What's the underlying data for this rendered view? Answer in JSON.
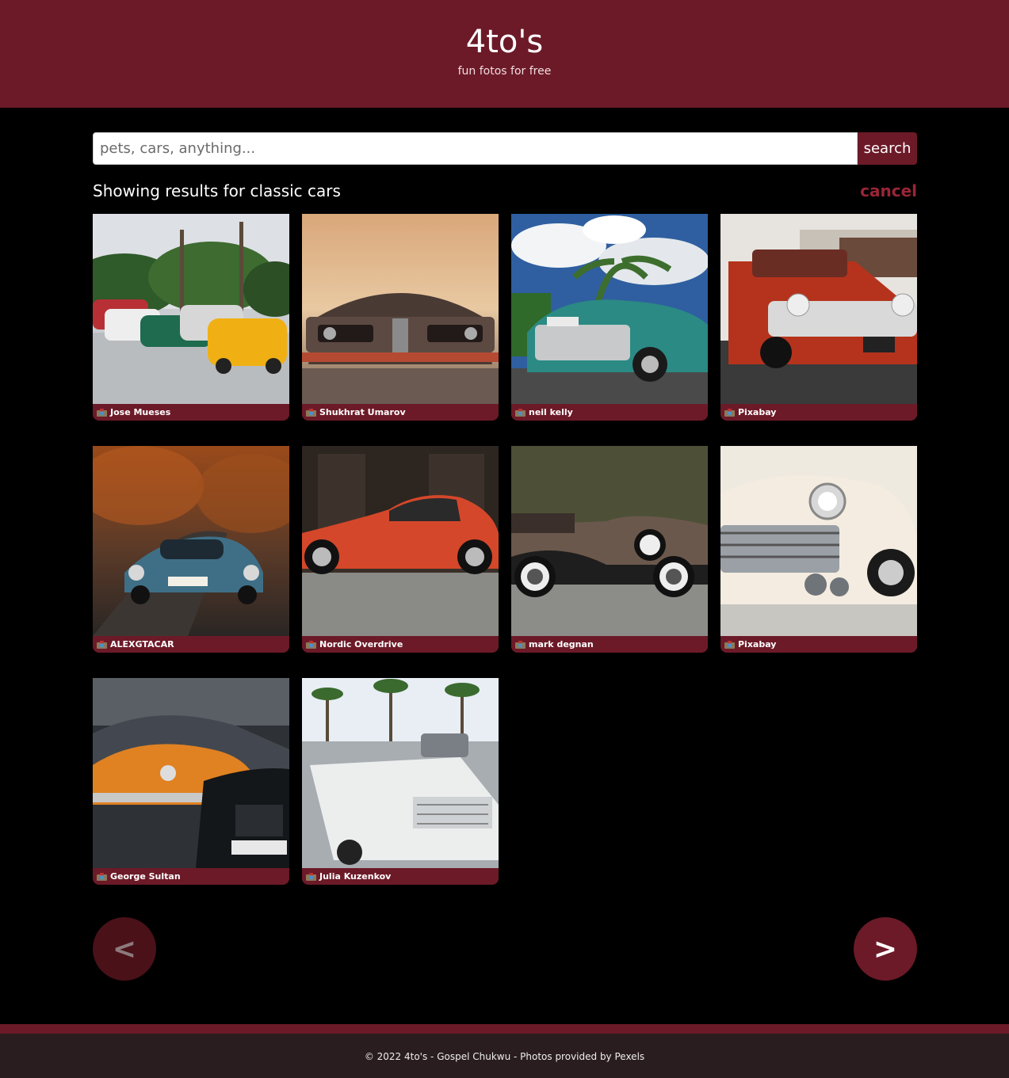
{
  "header": {
    "title": "4to's",
    "subtitle": "fun fotos for free"
  },
  "search": {
    "placeholder": "pets, cars, anything...",
    "value": "",
    "button_label": "search"
  },
  "results": {
    "label": "Showing results for classic cars",
    "cancel_label": "cancel"
  },
  "photos": [
    {
      "photographer": "Jose Mueses",
      "subject": "row of vintage cars with palm trees"
    },
    {
      "photographer": "Shukhrat Umarov",
      "subject": "muscle car front at sunset"
    },
    {
      "photographer": "neil kelly",
      "subject": "teal classic car under cloudy sky"
    },
    {
      "photographer": "Pixabay",
      "subject": "red classic car at a market"
    },
    {
      "photographer": "ALEXGTACAR",
      "subject": "blue alpine sports car on autumn road"
    },
    {
      "photographer": "Nordic Overdrive",
      "subject": "orange coupe side view"
    },
    {
      "photographer": "mark degnan",
      "subject": "brown vintage convertible"
    },
    {
      "photographer": "Pixabay",
      "subject": "cream classic car chrome front"
    },
    {
      "photographer": "George Sultan",
      "subject": "orange classic car in parking lot"
    },
    {
      "photographer": "Julia Kuzenkov",
      "subject": "white convertible on palm street"
    }
  ],
  "pagination": {
    "prev_label": "<",
    "next_label": ">"
  },
  "footer": {
    "text": "© 2022 4to's - Gospel Chukwu - Photos provided by Pexels"
  },
  "colors": {
    "brand": "#6c1a28",
    "background": "#000000",
    "cancel": "#9a2536"
  },
  "icons": {
    "caption": "camera-icon"
  }
}
